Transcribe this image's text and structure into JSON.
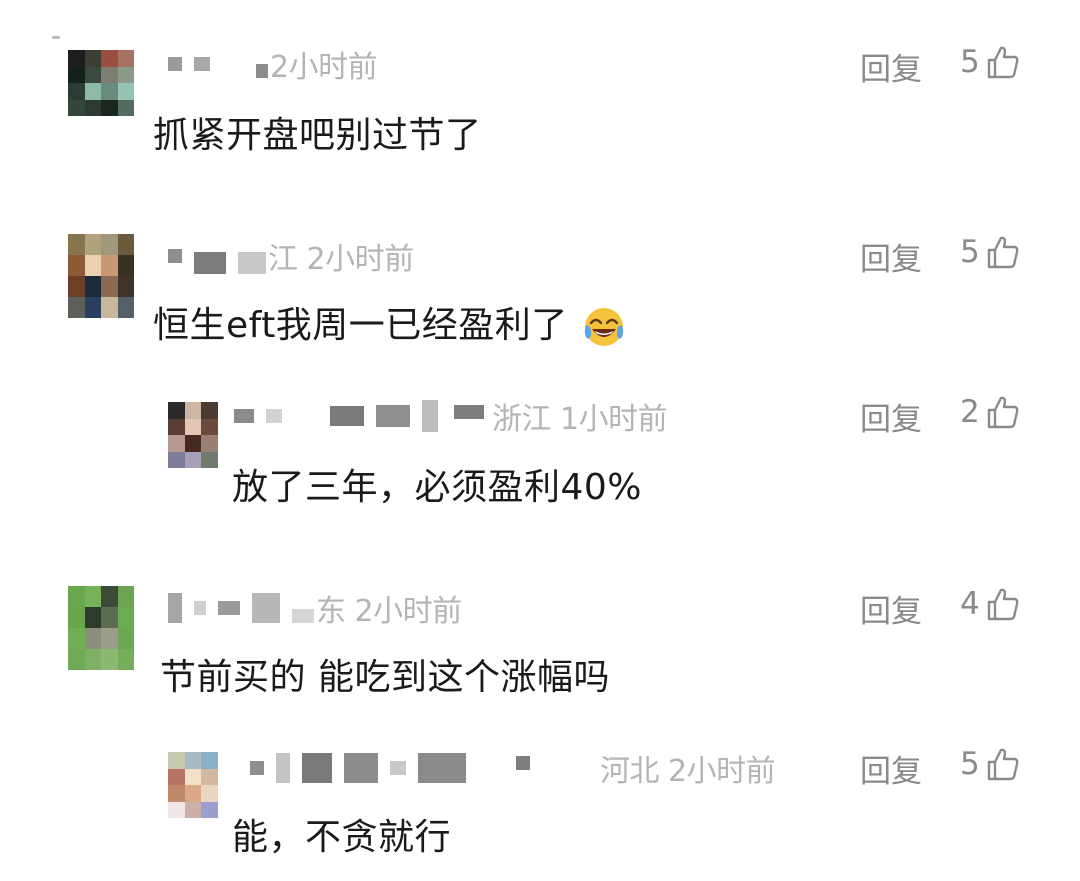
{
  "comments": [
    {
      "meta": "2小时前",
      "text": "抓紧开盘吧别过节了",
      "reply_label": "回复",
      "likes": "5",
      "avatar_colors": [
        "#1e1e1c",
        "#3c3f33",
        "#9b4d3f",
        "#a87263",
        "#12221b",
        "#394a3e",
        "#7c7f70",
        "#8a9b8b",
        "#2b3c35",
        "#8bbba7",
        "#6a8a7c",
        "#96c3b4",
        "#33463a",
        "#2c3a33",
        "#1b261f",
        "#556b60"
      ]
    },
    {
      "meta": "江 2小时前",
      "text": "恒生eft我周一已经盈利了",
      "emoji": "face-with-tears-of-joy-emoji",
      "reply_label": "回复",
      "likes": "5",
      "avatar_colors": [
        "#87754e",
        "#b1a37d",
        "#a0987c",
        "#6b5a3b",
        "#8b5a36",
        "#e9d0b0",
        "#c79a72",
        "#3b3122",
        "#6c3f27",
        "#1c2a3c",
        "#8b6a52",
        "#403226",
        "#5e5e5a",
        "#2c3f5e",
        "#c7b79b",
        "#575f66"
      ]
    },
    {
      "meta": "浙江 1小时前",
      "text": "放了三年，必须盈利40%",
      "reply_label": "回复",
      "likes": "2",
      "avatar_colors": [
        "#2c2a28",
        "#cdb7a4",
        "#4a3a31",
        "#5a3e35",
        "#e1c7b3",
        "#6b4a3e",
        "#b79a8f",
        "#442a22",
        "#9a7f74",
        "#7e7a9a",
        "#a8a0b7",
        "#6e7a6c"
      ]
    },
    {
      "meta": "东 2小时前",
      "text": "节前买的 能吃到这个涨幅吗",
      "reply_label": "回复",
      "likes": "4",
      "avatar_colors": [
        "#6aa84f",
        "#78b35a",
        "#3f4a38",
        "#6ca552",
        "#68a64c",
        "#2e3a2b",
        "#5d6d52",
        "#6bab51",
        "#71ad55",
        "#8a8f7d",
        "#9c9c8c",
        "#6ea653",
        "#6fa955",
        "#7fb065",
        "#8cb872",
        "#76ad5b"
      ]
    },
    {
      "meta": "河北 2小时前",
      "text": "能，不贪就行",
      "reply_label": "回复",
      "likes": "5",
      "avatar_colors": [
        "#c7cbb0",
        "#a7b9c3",
        "#8ab1c9",
        "#b77564",
        "#f2e0c8",
        "#d3b8a0",
        "#c08a6a",
        "#dba98a",
        "#e9d5c0",
        "#f0e6e8",
        "#cbb0a7",
        "#9b9fd0"
      ]
    }
  ]
}
